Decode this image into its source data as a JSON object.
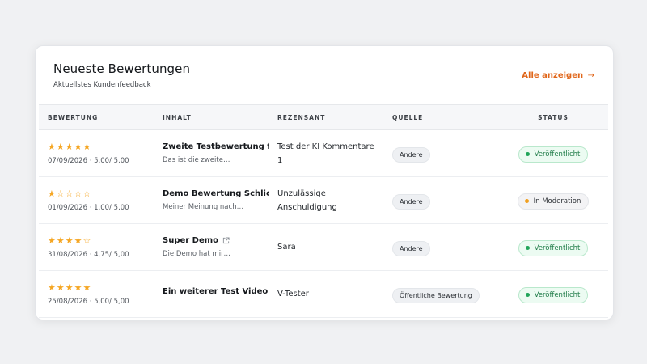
{
  "header": {
    "title": "Neueste Bewertungen",
    "subtitle": "Aktuellstes Kundenfeedback",
    "view_all": "Alle anzeigen",
    "view_all_arrow": "→"
  },
  "columns": {
    "rating": "BEWERTUNG",
    "content": "INHALT",
    "reviewer": "REZENSANT",
    "source": "QUELLE",
    "status": "STATUS"
  },
  "colors": {
    "accent": "#e0661a",
    "star": "#f5a623",
    "published": "#22a55a",
    "moderation": "#f0a020"
  },
  "rows": [
    {
      "stars": 5,
      "meta": "07/09/2026 · 5,00/ 5,00",
      "title": "Zweite Testbewertung f",
      "excerpt": "Das ist die zweite…",
      "external_link": false,
      "reviewer": "Test der KI Kommentare 1",
      "source": "Andere",
      "status": "Veröffentlicht",
      "status_type": "published"
    },
    {
      "stars": 1,
      "meta": "01/09/2026 · 1,00/ 5,00",
      "title": "Demo Bewertung Schlic",
      "excerpt": "Meiner Meinung nach…",
      "external_link": false,
      "reviewer": "Unzulässige Anschuldigung",
      "source": "Andere",
      "status": "In Moderation",
      "status_type": "moderation"
    },
    {
      "stars": 4,
      "meta": "31/08/2026 · 4,75/ 5,00",
      "title": "Super Demo",
      "excerpt": "Die Demo hat mir…",
      "external_link": true,
      "reviewer": "Sara",
      "source": "Andere",
      "status": "Veröffentlicht",
      "status_type": "published"
    },
    {
      "stars": 5,
      "meta": "25/08/2026 · 5,00/ 5,00",
      "title": "Ein weiterer Test Video",
      "excerpt": "",
      "external_link": false,
      "reviewer": "V-Tester",
      "source": "Öffentliche Bewertung",
      "status": "Veröffentlicht",
      "status_type": "published"
    }
  ]
}
